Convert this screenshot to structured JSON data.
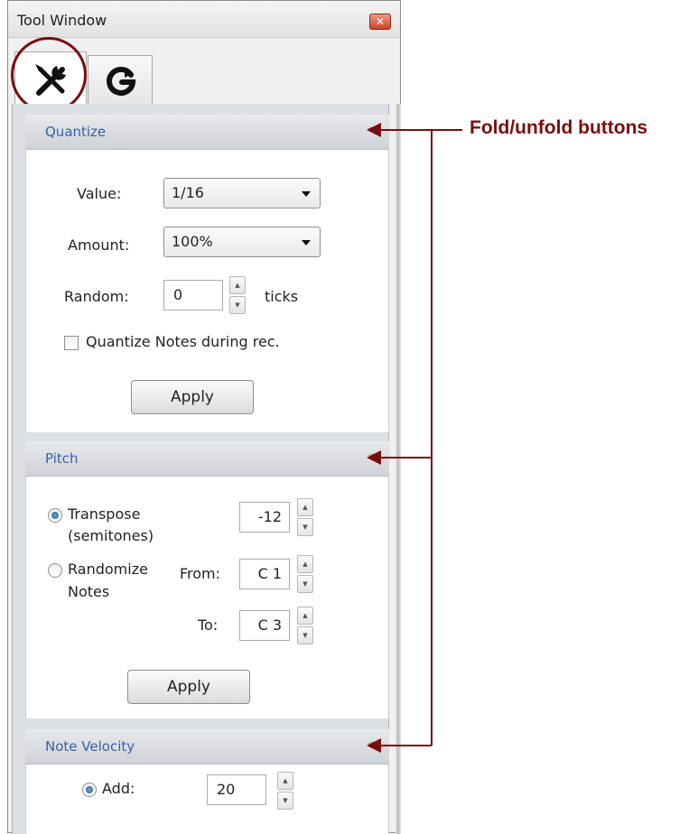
{
  "window": {
    "title": "Tool Window",
    "close_glyph": "✕"
  },
  "tabs": [
    {
      "name": "tools",
      "icon": "wrench-screwdriver-icon"
    },
    {
      "name": "snap",
      "icon": "refresh-g-icon"
    }
  ],
  "quantize": {
    "title": "Quantize",
    "value_label": "Value:",
    "value": "1/16",
    "amount_label": "Amount:",
    "amount": "100%",
    "random_label": "Random:",
    "random_value": "0",
    "random_unit": "ticks",
    "checkbox_label": "Quantize Notes during rec.",
    "checkbox_checked": false,
    "apply_label": "Apply"
  },
  "pitch": {
    "title": "Pitch",
    "transpose_label_1": "Transpose",
    "transpose_label_2": "(semitones)",
    "transpose_value": "-12",
    "transpose_selected": true,
    "randomize_label_1": "Randomize",
    "randomize_label_2": "Notes",
    "from_label": "From:",
    "from_value": "C 1",
    "to_label": "To:",
    "to_value": "C 3",
    "apply_label": "Apply"
  },
  "note_velocity": {
    "title": "Note Velocity",
    "add_label": "Add:",
    "add_value": "20",
    "add_selected": true
  },
  "annotation": {
    "text": "Fold/unfold buttons"
  },
  "colors": {
    "annotation": "#7a0d0d",
    "section_title": "#3a5fa8"
  }
}
